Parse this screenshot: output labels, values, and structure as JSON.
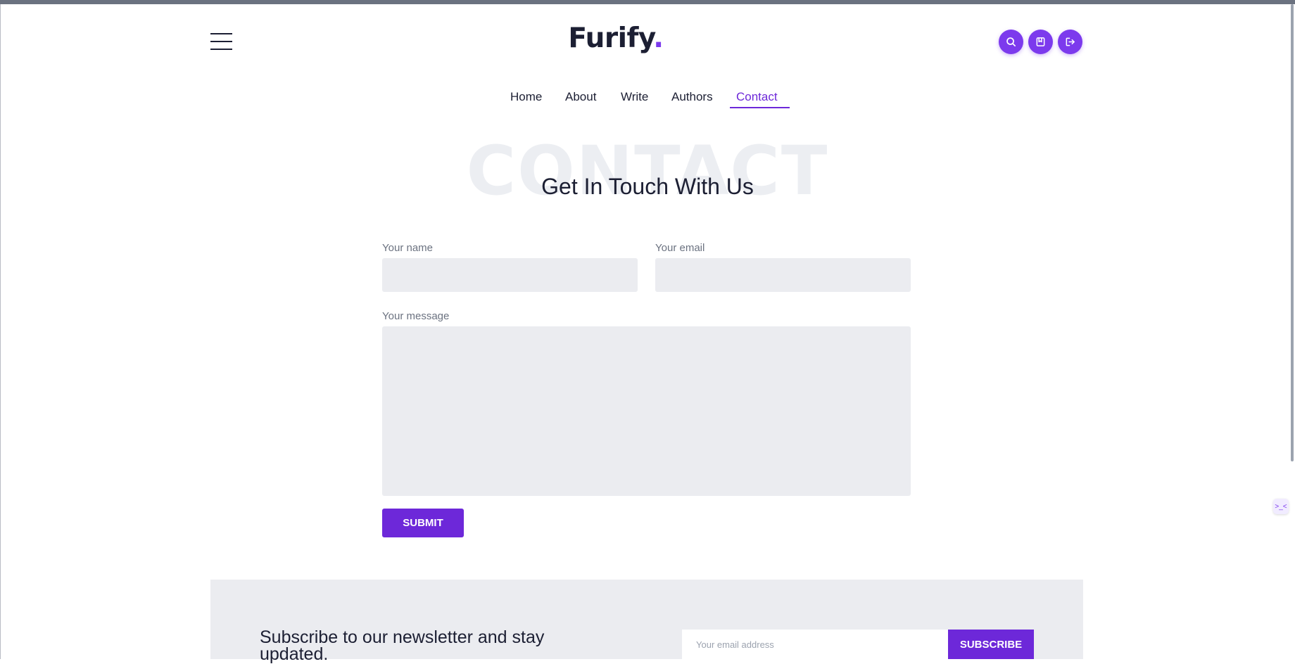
{
  "header": {
    "logo_text": "Furify",
    "logo_dot": ".",
    "icons": [
      "menu-icon",
      "search-icon",
      "bookmark-icon",
      "logout-icon"
    ]
  },
  "nav": {
    "items": [
      {
        "label": "Home"
      },
      {
        "label": "About"
      },
      {
        "label": "Write"
      },
      {
        "label": "Authors"
      },
      {
        "label": "Contact"
      }
    ],
    "active": "Contact"
  },
  "hero": {
    "background_word": "CONTACT",
    "title": "Get In Touch With Us"
  },
  "form": {
    "name_label": "Your name",
    "name_value": "",
    "email_label": "Your email",
    "email_value": "",
    "message_label": "Your message",
    "message_value": "",
    "submit_label": "SUBMIT"
  },
  "newsletter": {
    "heading": "Subscribe to our newsletter and stay updated.",
    "email_placeholder": "Your email address",
    "button_label": "SUBSCRIBE"
  },
  "widget": {
    "symbol": ">_<"
  },
  "colors": {
    "accent": "#6d28d9",
    "accent_light": "#7c3aed",
    "text": "#1c1f33",
    "field_bg": "#ebecf0"
  }
}
